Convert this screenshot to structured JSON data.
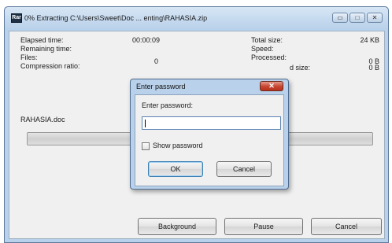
{
  "window": {
    "icon_text": "Rar",
    "title": "0% Extracting C:\\Users\\Sweet\\Doc ... enting\\RAHASIA.zip",
    "minimize_glyph": "▭",
    "maximize_glyph": "□",
    "close_glyph": "✕"
  },
  "stats": {
    "elapsed_label": "Elapsed time:",
    "elapsed_value": "00:00:09",
    "remaining_label": "Remaining time:",
    "files_label": "Files:",
    "files_value": "0",
    "ratio_label": "Compression ratio:",
    "total_size_label": "Total size:",
    "total_size_value": "24 KB",
    "speed_label": "Speed:",
    "processed_label": "Processed:",
    "processed_value": "0 B",
    "packed_size_label": "d size:",
    "packed_size_value": "0 B"
  },
  "current_file": "RAHASIA.doc",
  "progress_percent": 0,
  "buttons": {
    "background": "Background",
    "pause": "Pause",
    "cancel": "Cancel"
  },
  "dialog": {
    "title": "Enter password",
    "close_glyph": "✕",
    "prompt": "Enter password:",
    "password_value": "",
    "show_password_label": "Show password",
    "show_password_checked": false,
    "ok": "OK",
    "cancel": "Cancel"
  }
}
